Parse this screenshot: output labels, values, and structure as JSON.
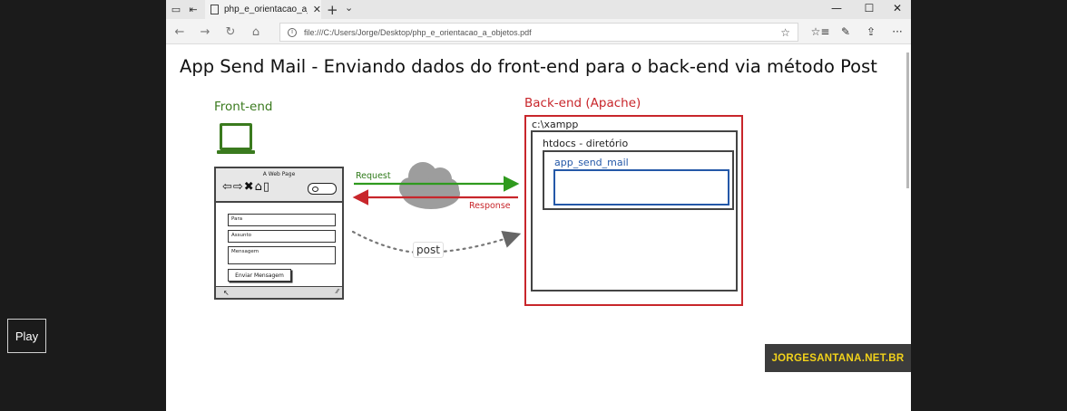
{
  "player": {
    "play_label": "Play"
  },
  "browser": {
    "tab": {
      "title": "php_e_orientacao_a_obj",
      "close": "✕"
    },
    "tab_new": "+",
    "tab_list": "⌄",
    "window": {
      "minimize": "—",
      "maximize": "☐",
      "close": "✕"
    },
    "nav": {
      "back": "←",
      "forward": "→",
      "refresh": "↻",
      "home": "⌂"
    },
    "address": {
      "url": "file:///C:/Users/Jorge/Desktop/php_e_orientacao_a_objetos.pdf",
      "star": "☆"
    },
    "tools": {
      "favorites": "☆≡",
      "notes": "✎",
      "share": "⇪",
      "more": "···"
    }
  },
  "slide": {
    "title": "App Send Mail - Enviando dados do front-end para o back-end via método Post",
    "front_label": "Front-end",
    "back_label": "Back-end (Apache)",
    "webpage": {
      "title": "A Web Page",
      "nav_icons": "⇦⇨✖⌂▯",
      "fields": [
        "Para",
        "Assunto",
        "Mensagem"
      ],
      "button": "Enviar Mensagem",
      "cursor": "↖",
      "resize": "⁄⁄"
    },
    "request_label": "Request",
    "response_label": "Response",
    "post_label": "post",
    "xampp_label": "c:\\xampp",
    "htdocs_label": "htdocs - diretório",
    "app_label": "app_send_mail",
    "watermark": "JORGESANTANA.NET.BR"
  },
  "colors": {
    "front": "#3a7a1e",
    "back": "#c8262b",
    "app": "#2458a8",
    "watermark_text": "#f2d21a",
    "cloud": "#9d9d9d"
  }
}
